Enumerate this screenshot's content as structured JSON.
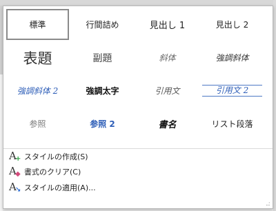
{
  "gallery": {
    "styles": [
      {
        "label": "標準",
        "selected": true
      },
      {
        "label": "行間詰め"
      },
      {
        "label": "見出し 1"
      },
      {
        "label": "見出し 2"
      },
      {
        "label": "表題"
      },
      {
        "label": "副題"
      },
      {
        "label": "斜体"
      },
      {
        "label": "強調斜体"
      },
      {
        "label": "強調斜体 2"
      },
      {
        "label": "強調太字"
      },
      {
        "label": "引用文"
      },
      {
        "label": "引用文 2"
      },
      {
        "label": "参照"
      },
      {
        "label": "参照 2"
      },
      {
        "label": "書名"
      },
      {
        "label": "リスト段落"
      }
    ]
  },
  "commands": [
    {
      "label": "スタイルの作成(S)",
      "icon": "new-style-icon"
    },
    {
      "label": "書式のクリア(C)",
      "icon": "clear-formatting-icon"
    },
    {
      "label": "スタイルの適用(A)...",
      "icon": "apply-styles-icon"
    }
  ],
  "colors": {
    "accent_blue": "#2f5fb8",
    "selected_border": "#8a8a8a"
  }
}
